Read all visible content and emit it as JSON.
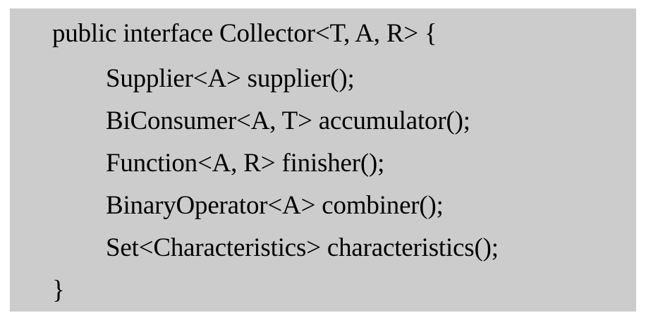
{
  "code": {
    "lines": [
      "public interface Collector<T, A, R> {",
      "Supplier<A> supplier();",
      "BiConsumer<A, T> accumulator();",
      "Function<A, R> finisher();",
      "BinaryOperator<A> combiner();",
      "Set<Characteristics> characteristics();",
      "}"
    ]
  },
  "colors": {
    "background": "#cccccc",
    "text": "#000000"
  }
}
